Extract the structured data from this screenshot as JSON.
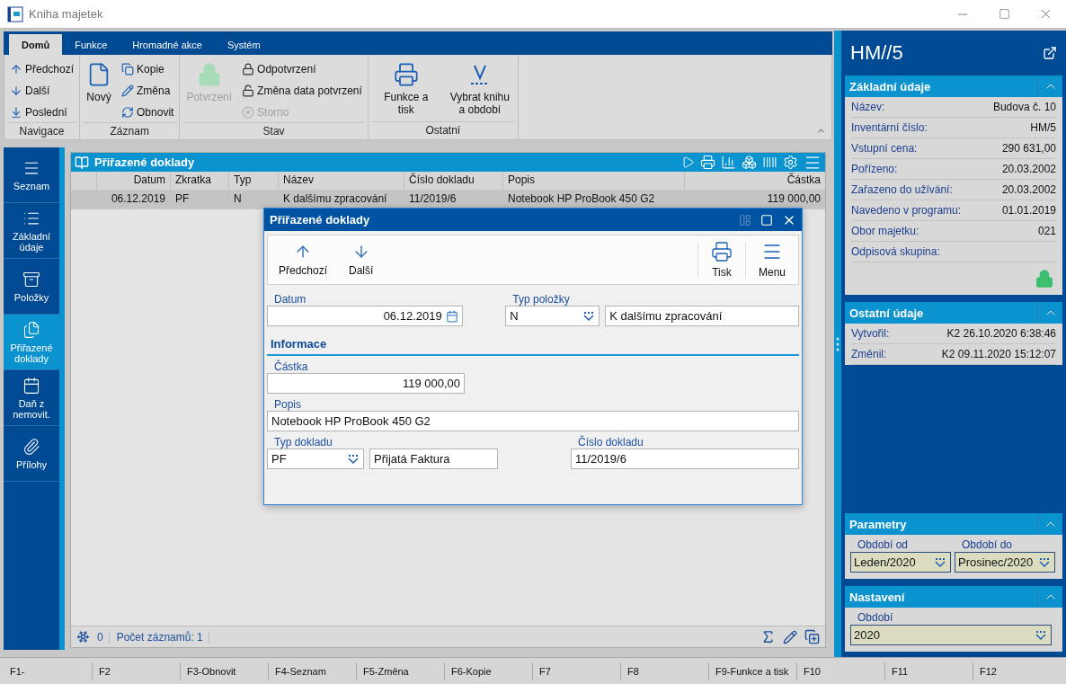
{
  "window": {
    "title": "Kniha majetek"
  },
  "ribbon": {
    "tabs": [
      {
        "label": "Domů",
        "selected": true
      },
      {
        "label": "Funkce",
        "selected": false
      },
      {
        "label": "Hromadné akce",
        "selected": false
      },
      {
        "label": "Systém",
        "selected": false
      }
    ],
    "groups": [
      {
        "title": "Navigace",
        "items": [
          {
            "label": "Předchozí",
            "kind": "small",
            "disabled": false
          },
          {
            "label": "Další",
            "kind": "small",
            "disabled": false
          },
          {
            "label": "Poslední",
            "kind": "small",
            "disabled": false
          }
        ]
      },
      {
        "title": "Záznam",
        "items": [
          {
            "label": "Nový",
            "kind": "large",
            "disabled": false
          },
          {
            "label": "Kopie",
            "kind": "small",
            "disabled": false
          },
          {
            "label": "Změna",
            "kind": "small",
            "disabled": false
          },
          {
            "label": "Obnovit",
            "kind": "small",
            "disabled": false
          }
        ]
      },
      {
        "title": "Stav",
        "items": [
          {
            "label": "Potvrzení",
            "kind": "large",
            "disabled": true
          },
          {
            "label": "Odpotvrzení",
            "kind": "small",
            "disabled": false
          },
          {
            "label": "Změna data potvrzení",
            "kind": "small",
            "disabled": false
          },
          {
            "label": "Storno",
            "kind": "small",
            "disabled": true
          }
        ]
      },
      {
        "title": "Ostatní",
        "items": [
          {
            "label": "Funkce a tisk",
            "kind": "large",
            "disabled": false
          },
          {
            "label": "Vybrat knihu a období",
            "kind": "large",
            "disabled": false
          }
        ]
      }
    ]
  },
  "sidebar": {
    "items": [
      {
        "label": "Seznam",
        "selected": false
      },
      {
        "label": "Základní údaje",
        "selected": false
      },
      {
        "label": "Položky",
        "selected": false
      },
      {
        "label": "Přiřazené doklady",
        "selected": true
      },
      {
        "label": "Daň z nemovit.",
        "selected": false
      },
      {
        "label": "Přílohy",
        "selected": false
      }
    ]
  },
  "table": {
    "title": "Přiřazené doklady",
    "columns": [
      "Datum",
      "Zkratka",
      "Typ",
      "Název",
      "Číslo dokladu",
      "Popis",
      "Částka"
    ],
    "rows": [
      {
        "cells": [
          "06.12.2019",
          "PF",
          "N",
          "K dalšímu zpracování",
          "11/2019/6",
          "Notebook HP ProBook 450 G2",
          "119 000,00"
        ],
        "selected": true
      }
    ],
    "footer": {
      "count": "0",
      "records": "Počet záznamů: 1"
    }
  },
  "dialog": {
    "title": "Přiřazené doklady",
    "toolbar_left": [
      "Předchozí",
      "Další"
    ],
    "toolbar_right": [
      "Tisk",
      "Menu"
    ],
    "datum": {
      "label": "Datum",
      "value": "06.12.2019"
    },
    "typ_polozky": {
      "label": "Typ položky",
      "value": "N",
      "description": "K dalšímu zpracování"
    },
    "section": "Informace",
    "castka": {
      "label": "Částka",
      "value": "119 000,00"
    },
    "popis": {
      "label": "Popis",
      "value": "Notebook HP ProBook 450 G2"
    },
    "typ_dokladu": {
      "label": "Typ dokladu",
      "value": "PF",
      "description": "Přijatá Faktura"
    },
    "cislo_dokladu": {
      "label": "Číslo dokladu",
      "value": "11/2019/6"
    }
  },
  "record_title": "HM//5",
  "info_sections": [
    {
      "title": "Základní údaje",
      "expanded": true,
      "locked": true,
      "rows": [
        {
          "label": "Název:",
          "value": "Budova č. 10"
        },
        {
          "label": "Inventární číslo:",
          "value": "HM/5"
        },
        {
          "label": "Vstupní cena:",
          "value": "290 631,00"
        },
        {
          "label": "Pořízeno:",
          "value": "20.03.2002"
        },
        {
          "label": "Zařazeno do užívání:",
          "value": "20.03.2002"
        },
        {
          "label": "Navedeno v programu:",
          "value": "01.01.2019"
        },
        {
          "label": "Obor majetku:",
          "value": "021"
        },
        {
          "label": "Odpisová skupina:"
        }
      ]
    },
    {
      "title": "Ostatní údaje",
      "expanded": true,
      "locked": false,
      "rows": [
        {
          "label": "Vytvořil:",
          "value": "K2 26.10.2020 6:38:46"
        },
        {
          "label": "Změnil:",
          "value": "K2 09.11.2020 15:12:07"
        }
      ]
    }
  ],
  "param_sections": [
    {
      "title": "Parametry",
      "expanded": true,
      "fields": [
        {
          "label": "Období od",
          "value": "Leden/2020"
        },
        {
          "label": "Období do",
          "value": "Prosinec/2020"
        }
      ]
    },
    {
      "title": "Nastavení",
      "expanded": true,
      "fields": [
        {
          "label": "Období",
          "value": "2020"
        }
      ]
    }
  ],
  "function_keys": [
    "F1-",
    "F2",
    "F3-Obnovit",
    "F4-Seznam",
    "F5-Změna",
    "F6-Kopie",
    "F7",
    "F8",
    "F9-Funkce a tisk",
    "F10",
    "F11",
    "F12"
  ]
}
